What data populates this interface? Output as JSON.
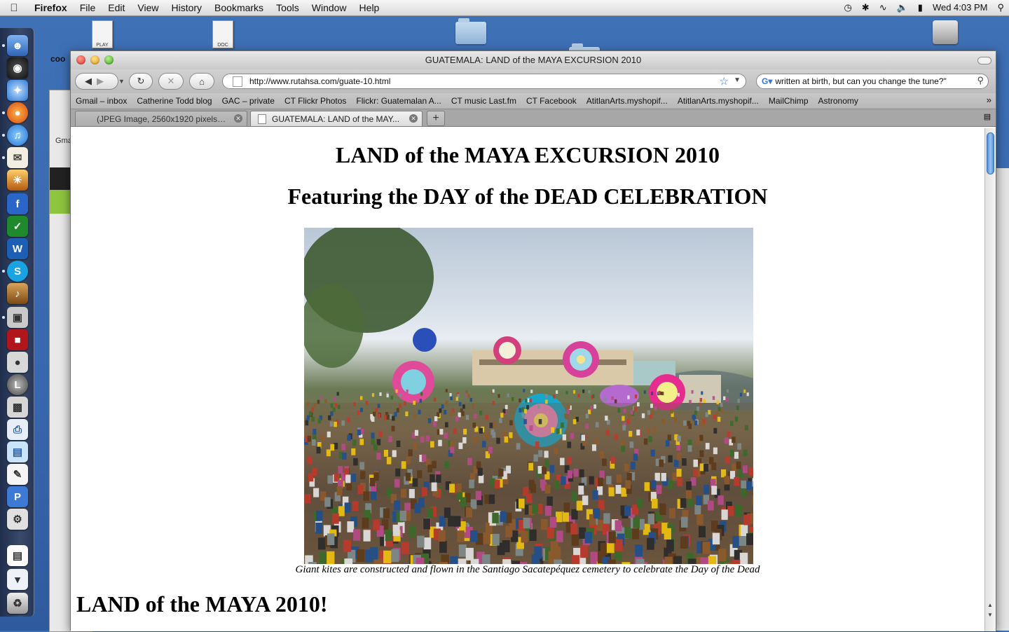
{
  "menubar": {
    "app": "Firefox",
    "items": [
      "File",
      "Edit",
      "View",
      "History",
      "Bookmarks",
      "Tools",
      "Window",
      "Help"
    ],
    "clock": "Wed 4:03 PM"
  },
  "desktop": {
    "play_label": "PLAY",
    "doc_label": "DOC",
    "bg_window_label": "coo",
    "bg_window_tab": "Gma"
  },
  "browser": {
    "title": "GUATEMALA: LAND of the MAYA EXCURSION 2010",
    "url": "http://www.rutahsa.com/guate-10.html",
    "search_value": "written at birth, but can you change the tune?\"",
    "bookmarks": [
      "Gmail – inbox",
      "Catherine Todd blog",
      "GAC – private",
      "CT Flickr Photos",
      "Flickr: Guatemalan A...",
      "CT music Last.fm",
      "CT Facebook",
      "AtitlanArts.myshopif...",
      "AtitlanArts.myshopif...",
      "MailChimp",
      "Astronomy"
    ],
    "tabs": [
      {
        "label": "(JPEG Image, 2560x1920 pixels)..."
      },
      {
        "label": "GUATEMALA: LAND of the MAY..."
      }
    ]
  },
  "page": {
    "heading1": "LAND of the MAYA EXCURSION 2010",
    "heading2": "Featuring the DAY of the DEAD CELEBRATION",
    "caption": "Giant kites are constructed and flown in the Santiago Sacatepéquez cemetery to celebrate the Day of the Dead",
    "heading3": "LAND of the MAYA 2010!"
  },
  "colors": {
    "desktop": "#3d6fb4",
    "scroll_thumb": "#4f8ed8"
  }
}
